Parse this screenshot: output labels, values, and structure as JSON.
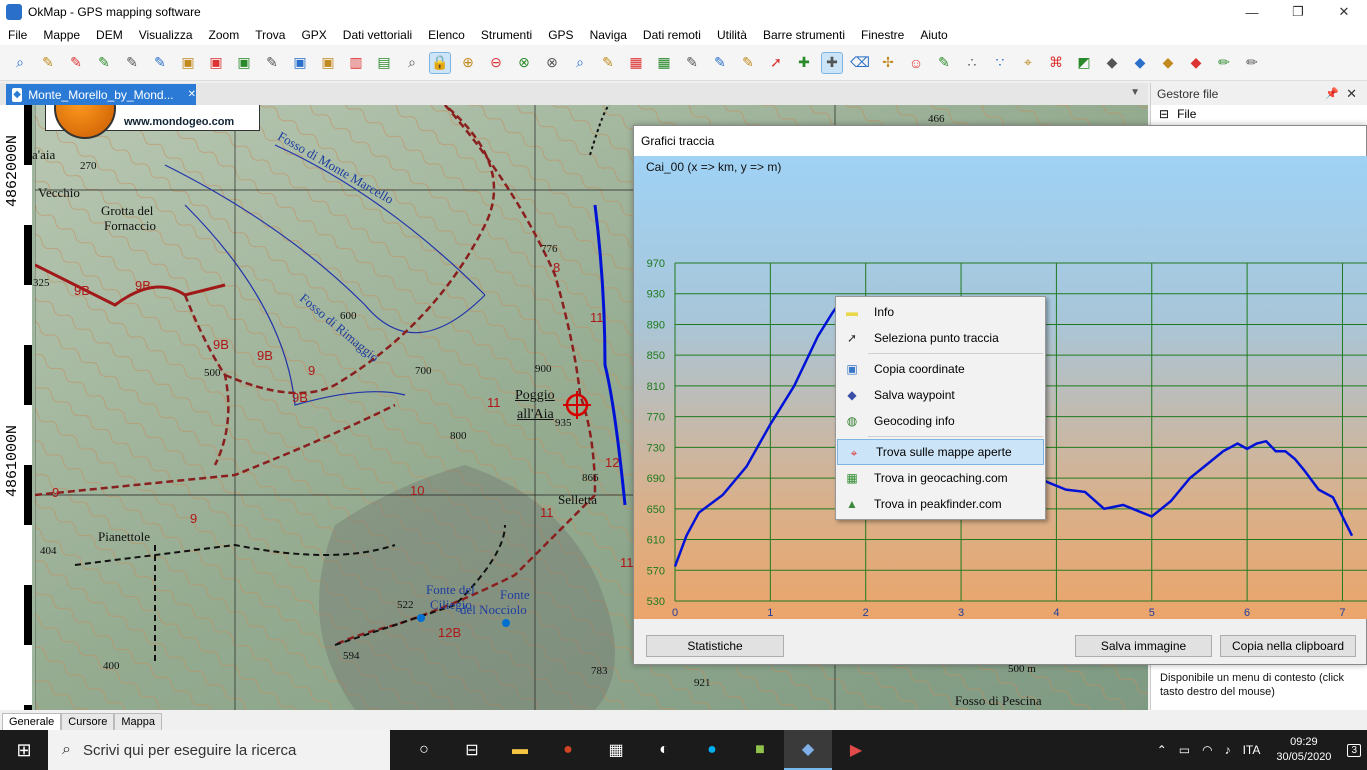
{
  "window": {
    "title": "OkMap - GPS mapping software",
    "minimize": "—",
    "restore": "❐",
    "close": "✕"
  },
  "menu": [
    "File",
    "Mappe",
    "DEM",
    "Visualizza",
    "Zoom",
    "Trova",
    "GPX",
    "Dati vettoriali",
    "Elenco",
    "Strumenti",
    "GPS",
    "Naviga",
    "Dati remoti",
    "Utilità",
    "Barre strumenti",
    "Finestre",
    "Aiuto"
  ],
  "document_tab": {
    "label": "Monte_Morello_by_Mond...",
    "close": "✕"
  },
  "map": {
    "ruler_labels": [
      "4862000N",
      "4861000N"
    ],
    "logo_text": "www.mondogeo.com",
    "place_labels": [
      {
        "text": "Poggio",
        "cls": "big"
      },
      {
        "text": "all'Aia",
        "cls": "big"
      },
      {
        "text": "Grotta del",
        "cls": ""
      },
      {
        "text": "Fornaccio",
        "cls": ""
      },
      {
        "text": "Vecchio",
        "cls": ""
      },
      {
        "text": "Pianettole",
        "cls": ""
      },
      {
        "text": "Selletta",
        "cls": ""
      },
      {
        "text": "Fonte del",
        "cls": "blue"
      },
      {
        "text": "Ciliegio",
        "cls": "blue"
      },
      {
        "text": "Fonte",
        "cls": "blue"
      },
      {
        "text": "del Nocciolo",
        "cls": "blue"
      },
      {
        "text": "Fosso di Monte Marcello",
        "cls": "blue"
      },
      {
        "text": "Fosso di Rimaggio",
        "cls": "blue"
      },
      {
        "text": "Fosso di Pescina",
        "cls": ""
      },
      {
        "text": "a'aia",
        "cls": ""
      }
    ],
    "elevations": [
      "270",
      "325",
      "404",
      "466",
      "522",
      "594",
      "600",
      "700",
      "776",
      "783",
      "800",
      "866",
      "900",
      "921",
      "935",
      "500",
      "400",
      "500 m"
    ],
    "trail_labels": [
      "9B",
      "9B",
      "9B",
      "9B",
      "9B",
      "9",
      "9",
      "10",
      "11",
      "11",
      "12",
      "12B",
      "11B",
      "8",
      "11",
      "9"
    ]
  },
  "side_panel": {
    "title": "Gestore file",
    "pin": "📌",
    "close": "✕",
    "tree_expander": "⊟",
    "tree_root": "File",
    "note": "Disponibile un menu di contesto (click tasto destro del mouse)"
  },
  "graph": {
    "title": "Grafici traccia",
    "caption": "Cai_00 (x => km, y => m)",
    "buttons": {
      "stats": "Statistiche",
      "save": "Salva immagine",
      "copy": "Copia nella clipboard"
    }
  },
  "chart_data": {
    "type": "line",
    "xlim": [
      0,
      7.1
    ],
    "ylim": [
      530,
      970
    ],
    "x_ticks": [
      0,
      1,
      2,
      3,
      4,
      5,
      6,
      7
    ],
    "y_ticks": [
      530,
      570,
      610,
      650,
      690,
      730,
      770,
      810,
      850,
      890,
      930,
      970
    ],
    "grid": true,
    "line_color": "#0012d6",
    "x": [
      0,
      0.12,
      0.25,
      0.5,
      0.75,
      1.0,
      1.25,
      1.5,
      1.65,
      1.75,
      1.85,
      1.95,
      2.1,
      2.3,
      2.5,
      2.7,
      2.9,
      3.1,
      3.3,
      3.5,
      3.7,
      3.9,
      4.1,
      4.3,
      4.5,
      4.7,
      4.9,
      5.0,
      5.2,
      5.4,
      5.6,
      5.75,
      5.9,
      6.0,
      6.1,
      6.2,
      6.3,
      6.4,
      6.5,
      6.6,
      6.75,
      6.9,
      7.0,
      7.1
    ],
    "y": [
      575,
      615,
      645,
      668,
      705,
      760,
      810,
      875,
      905,
      922,
      905,
      880,
      855,
      830,
      800,
      775,
      755,
      740,
      735,
      720,
      700,
      685,
      675,
      672,
      650,
      655,
      645,
      640,
      660,
      690,
      710,
      725,
      735,
      728,
      735,
      738,
      725,
      725,
      715,
      700,
      675,
      665,
      640,
      615
    ]
  },
  "context_menu": {
    "items": [
      {
        "label": "Info",
        "icon": "folder-icon"
      },
      {
        "label": "Seleziona punto traccia",
        "icon": "cursor-icon"
      },
      {
        "label": "Copia coordinate",
        "icon": "copy-icon"
      },
      {
        "label": "Salva waypoint",
        "icon": "waypoint-icon"
      },
      {
        "label": "Geocoding info",
        "icon": "globe-icon"
      },
      {
        "label": "Trova sulle mappe aperte",
        "icon": "find-map-icon"
      },
      {
        "label": "Trova in geocaching.com",
        "icon": "geocaching-icon"
      },
      {
        "label": "Trova in peakfinder.com",
        "icon": "peak-icon"
      }
    ]
  },
  "bottom_tabs": [
    "Generale",
    "Cursore",
    "Mappa"
  ],
  "taskbar": {
    "search_placeholder": "Scrivi qui per eseguire la ricerca",
    "language": "ITA",
    "time": "09:29",
    "date": "30/05/2020",
    "notifications": "3"
  }
}
